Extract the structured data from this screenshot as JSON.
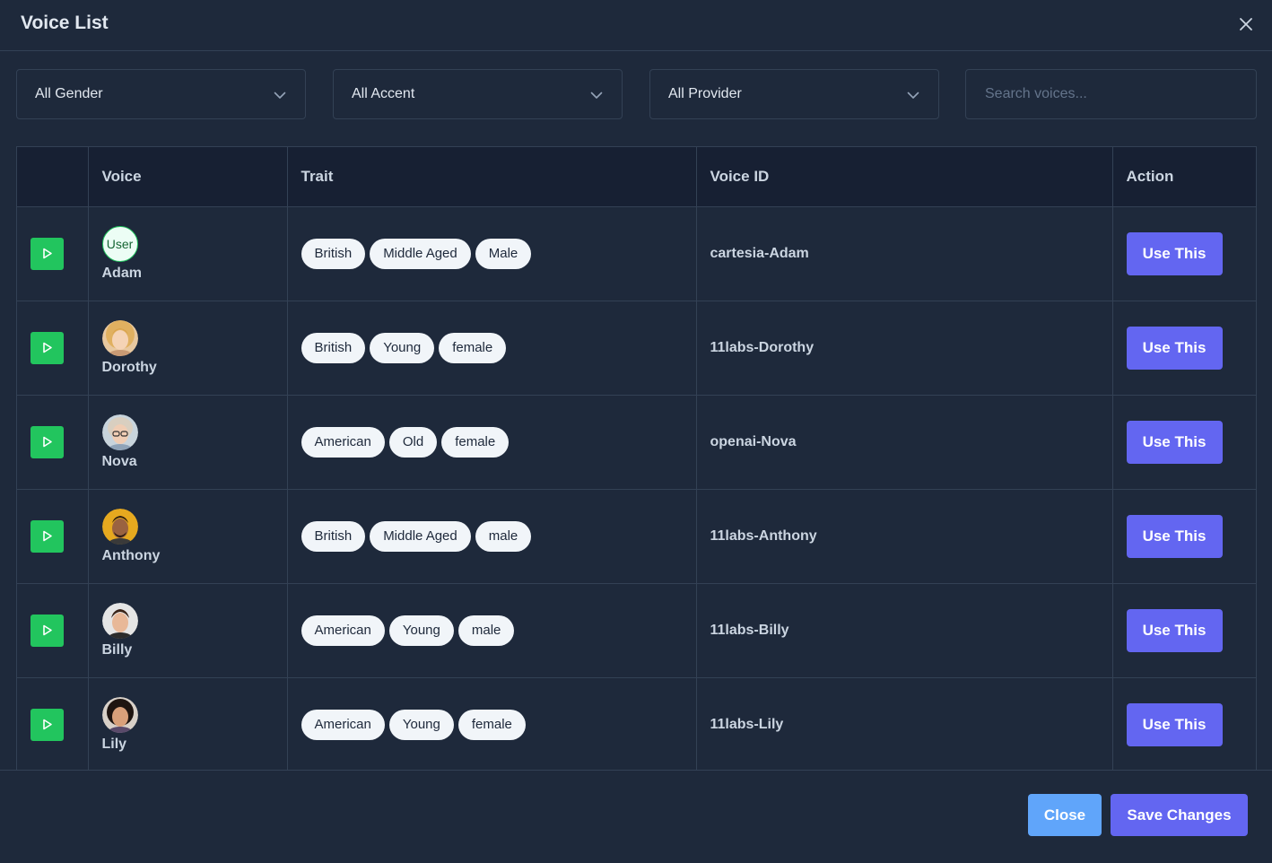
{
  "modal": {
    "title": "Voice List",
    "close_icon": "close-icon"
  },
  "filters": {
    "gender": "All Gender",
    "accent": "All Accent",
    "provider": "All Provider",
    "search_placeholder": "Search voices..."
  },
  "table": {
    "headers": [
      "",
      "Voice",
      "Trait",
      "Voice ID",
      "Action"
    ],
    "rows": [
      {
        "name": "Adam",
        "avatar_text": "User",
        "traits": [
          "British",
          "Middle Aged",
          "Male"
        ],
        "voice_id": "cartesia-Adam",
        "action": "Use This"
      },
      {
        "name": "Dorothy",
        "traits": [
          "British",
          "Young",
          "female"
        ],
        "voice_id": "11labs-Dorothy",
        "action": "Use This"
      },
      {
        "name": "Nova",
        "traits": [
          "American",
          "Old",
          "female"
        ],
        "voice_id": "openai-Nova",
        "action": "Use This"
      },
      {
        "name": "Anthony",
        "traits": [
          "British",
          "Middle Aged",
          "male"
        ],
        "voice_id": "11labs-Anthony",
        "action": "Use This"
      },
      {
        "name": "Billy",
        "traits": [
          "American",
          "Young",
          "male"
        ],
        "voice_id": "11labs-Billy",
        "action": "Use This"
      },
      {
        "name": "Lily",
        "traits": [
          "American",
          "Young",
          "female"
        ],
        "voice_id": "11labs-Lily",
        "action": "Use This"
      }
    ]
  },
  "footer": {
    "close_label": "Close",
    "save_label": "Save Changes"
  },
  "colors": {
    "background": "#1e293b",
    "play": "#22c55e",
    "primary": "#6366f1",
    "close_button": "#60a5fa"
  }
}
